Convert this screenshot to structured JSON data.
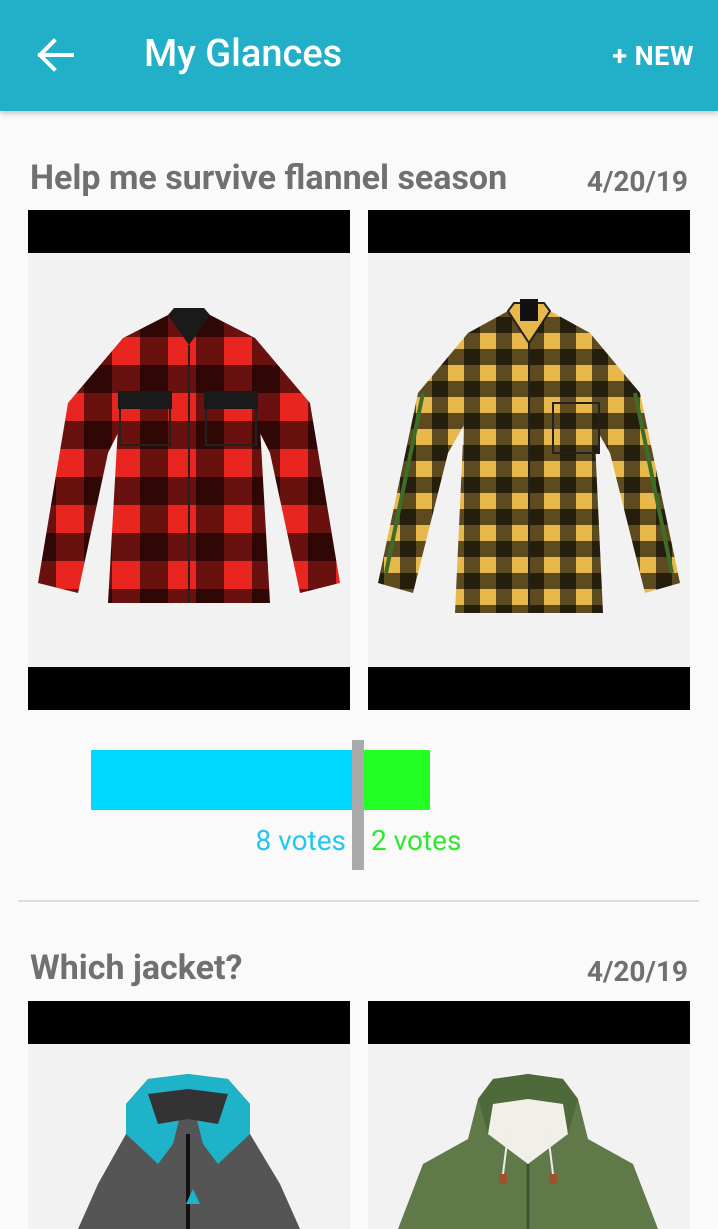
{
  "app_bar": {
    "title": "My Glances",
    "new_label": "+ NEW",
    "back_icon": "arrow-left-icon",
    "color": "#21b0c8"
  },
  "glances": [
    {
      "title": "Help me survive flannel season",
      "date": "4/20/19",
      "options": [
        {
          "name": "red-black-flannel-shirt",
          "votes_label": "8 votes",
          "votes": 8,
          "color": "#00d9ff"
        },
        {
          "name": "yellow-black-flannel-shirt",
          "votes_label": "2 votes",
          "votes": 2,
          "color": "#22ff22"
        }
      ]
    },
    {
      "title": "Which jacket?",
      "date": "4/20/19",
      "options": [
        {
          "name": "teal-gray-rain-jacket"
        },
        {
          "name": "olive-green-parka"
        }
      ]
    }
  ]
}
